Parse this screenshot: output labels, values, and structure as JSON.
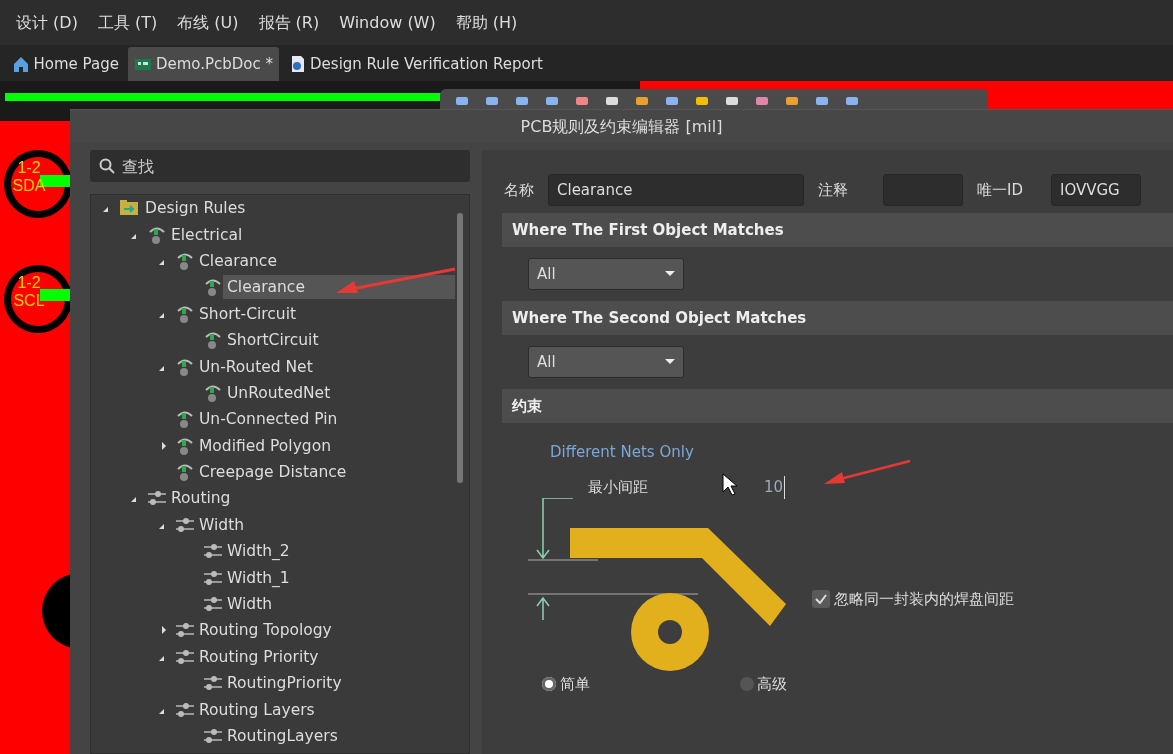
{
  "menu": [
    "设计 (D)",
    "工具 (T)",
    "布线 (U)",
    "报告 (R)",
    "Window (W)",
    "帮助 (H)"
  ],
  "tabs": [
    {
      "label": "Home Page",
      "kind": "home",
      "selected": false
    },
    {
      "label": "Demo.PcbDoc *",
      "kind": "pcb",
      "selected": true
    },
    {
      "label": "Design Rule Verification Report",
      "kind": "report",
      "selected": false
    }
  ],
  "pads": [
    {
      "number": "1-2",
      "net": "SDA"
    },
    {
      "number": "1-2",
      "net": "SCL"
    }
  ],
  "dialog": {
    "title": "PCB规则及约束编辑器 [mil]",
    "search": {
      "placeholder": "查找"
    },
    "tree": [
      {
        "label": "Design Rules",
        "kind": "folder",
        "expanded": true,
        "selected": false,
        "children": [
          {
            "label": "Electrical",
            "kind": "electrical",
            "expanded": true,
            "selected": false,
            "children": [
              {
                "label": "Clearance",
                "kind": "electrical",
                "expanded": true,
                "selected": false,
                "children": [
                  {
                    "label": "Clearance",
                    "kind": "electrical",
                    "selected": true
                  }
                ]
              },
              {
                "label": "Short-Circuit",
                "kind": "electrical",
                "expanded": true,
                "selected": false,
                "children": [
                  {
                    "label": "ShortCircuit",
                    "kind": "electrical",
                    "selected": false
                  }
                ]
              },
              {
                "label": "Un-Routed Net",
                "kind": "electrical",
                "expanded": true,
                "selected": false,
                "children": [
                  {
                    "label": "UnRoutedNet",
                    "kind": "electrical",
                    "selected": false
                  }
                ]
              },
              {
                "label": "Un-Connected Pin",
                "kind": "electrical",
                "selected": false
              },
              {
                "label": "Modified Polygon",
                "kind": "electrical",
                "expanded": false,
                "selected": false
              },
              {
                "label": "Creepage Distance",
                "kind": "electrical",
                "selected": false
              }
            ]
          },
          {
            "label": "Routing",
            "kind": "routing",
            "expanded": true,
            "selected": false,
            "children": [
              {
                "label": "Width",
                "kind": "routing",
                "expanded": true,
                "selected": false,
                "children": [
                  {
                    "label": "Width_2",
                    "kind": "routing",
                    "selected": false
                  },
                  {
                    "label": "Width_1",
                    "kind": "routing",
                    "selected": false
                  },
                  {
                    "label": "Width",
                    "kind": "routing",
                    "selected": false
                  }
                ]
              },
              {
                "label": "Routing Topology",
                "kind": "routing",
                "expanded": false,
                "selected": false
              },
              {
                "label": "Routing Priority",
                "kind": "routing",
                "expanded": true,
                "selected": false,
                "children": [
                  {
                    "label": "RoutingPriority",
                    "kind": "routing",
                    "selected": false
                  }
                ]
              },
              {
                "label": "Routing Layers",
                "kind": "routing",
                "expanded": true,
                "selected": false,
                "children": [
                  {
                    "label": "RoutingLayers",
                    "kind": "routing",
                    "selected": false
                  }
                ]
              }
            ]
          }
        ]
      }
    ],
    "name_label": "名称",
    "name_value": "Clearance",
    "comment_label": "注释",
    "id_label": "唯一ID",
    "id_value": "IOVVGG",
    "first_header": "Where The First Object Matches",
    "first_value": "All",
    "second_header": "Where The Second Object Matches",
    "second_value": "All",
    "constraints_header": "约束",
    "net_scope": "Different Nets Only",
    "min_clearance_label": "最小间距",
    "min_clearance_value": "10",
    "ignore_pads": {
      "label": "忽略同一封装内的焊盘间距",
      "checked": true
    },
    "modes": [
      {
        "label": "简单",
        "selected": true
      },
      {
        "label": "高级",
        "selected": false
      }
    ]
  }
}
